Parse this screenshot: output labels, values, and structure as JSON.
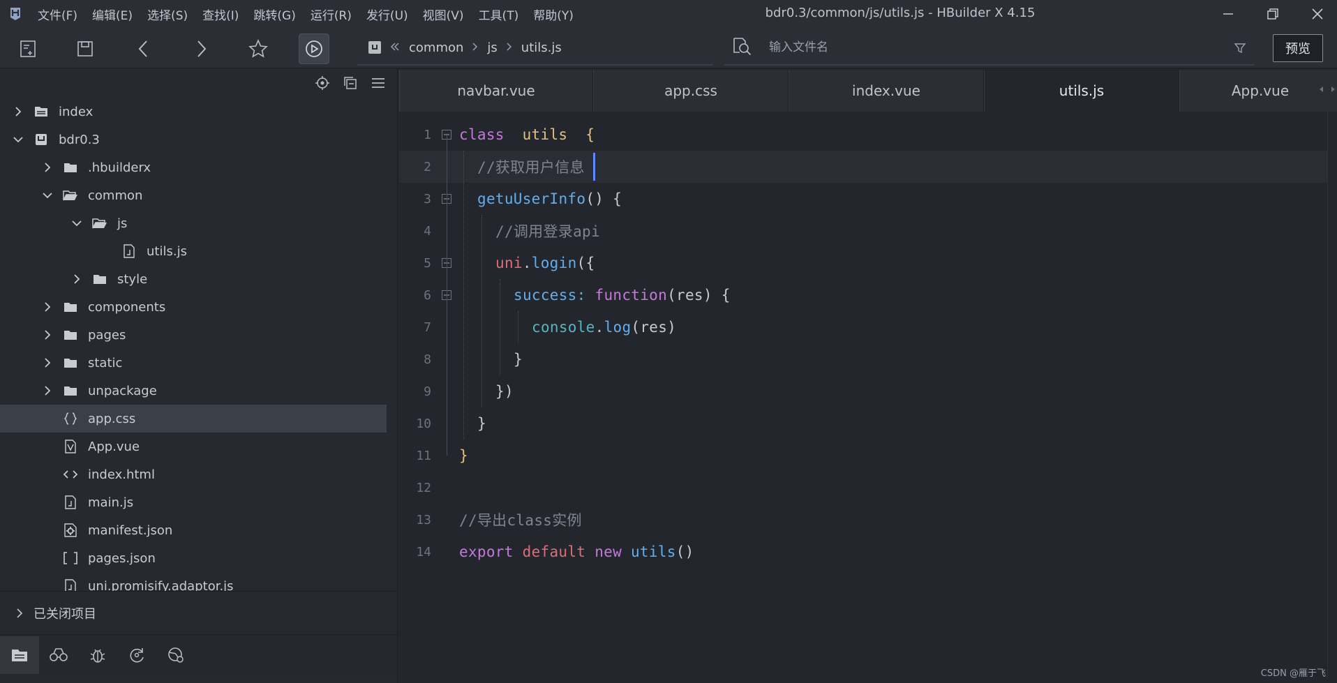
{
  "window": {
    "title": "bdr0.3/common/js/utils.js - HBuilder X 4.15"
  },
  "menu": [
    "文件(F)",
    "编辑(E)",
    "选择(S)",
    "查找(I)",
    "跳转(G)",
    "运行(R)",
    "发行(U)",
    "视图(V)",
    "工具(T)",
    "帮助(Y)"
  ],
  "toolbar": {
    "breadcrumb": [
      "common",
      "js",
      "utils.js"
    ],
    "search_placeholder": "输入文件名",
    "preview_label": "预览"
  },
  "sidebar": {
    "tree": [
      {
        "label": "index",
        "depth": 0,
        "chevron": "right",
        "icon": "project-icon"
      },
      {
        "label": "bdr0.3",
        "depth": 0,
        "chevron": "down",
        "icon": "uniapp-project-icon"
      },
      {
        "label": ".hbuilderx",
        "depth": 1,
        "chevron": "right",
        "icon": "folder-icon"
      },
      {
        "label": "common",
        "depth": 1,
        "chevron": "down",
        "icon": "folder-open-icon"
      },
      {
        "label": "js",
        "depth": 2,
        "chevron": "down",
        "icon": "folder-open-icon"
      },
      {
        "label": "utils.js",
        "depth": 3,
        "chevron": "none",
        "icon": "js-file-icon"
      },
      {
        "label": "style",
        "depth": 2,
        "chevron": "right",
        "icon": "folder-icon"
      },
      {
        "label": "components",
        "depth": 1,
        "chevron": "right",
        "icon": "folder-icon"
      },
      {
        "label": "pages",
        "depth": 1,
        "chevron": "right",
        "icon": "folder-icon"
      },
      {
        "label": "static",
        "depth": 1,
        "chevron": "right",
        "icon": "folder-icon"
      },
      {
        "label": "unpackage",
        "depth": 1,
        "chevron": "right",
        "icon": "folder-icon"
      },
      {
        "label": "app.css",
        "depth": 1,
        "chevron": "none",
        "icon": "css-file-icon",
        "selected": true
      },
      {
        "label": "App.vue",
        "depth": 1,
        "chevron": "none",
        "icon": "vue-file-icon"
      },
      {
        "label": "index.html",
        "depth": 1,
        "chevron": "none",
        "icon": "html-file-icon"
      },
      {
        "label": "main.js",
        "depth": 1,
        "chevron": "none",
        "icon": "js-file-icon"
      },
      {
        "label": "manifest.json",
        "depth": 1,
        "chevron": "none",
        "icon": "manifest-file-icon"
      },
      {
        "label": "pages.json",
        "depth": 1,
        "chevron": "none",
        "icon": "json-file-icon"
      },
      {
        "label": "uni.promisify.adaptor.js",
        "depth": 1,
        "chevron": "none",
        "icon": "js-file-icon"
      }
    ],
    "closed_projects_label": "已关闭项目"
  },
  "tabs": [
    {
      "label": "navbar.vue",
      "active": false
    },
    {
      "label": "app.css",
      "active": false
    },
    {
      "label": "index.vue",
      "active": false
    },
    {
      "label": "utils.js",
      "active": true
    },
    {
      "label": "App.vue",
      "active": false
    }
  ],
  "editor": {
    "current_line": 2,
    "lines": [
      {
        "num": "1",
        "fold": true,
        "indent": 0,
        "tokens": [
          [
            "kw-purple",
            "class"
          ],
          [
            "",
            "  "
          ],
          [
            "cls-yellow",
            "utils"
          ],
          [
            "",
            "  "
          ],
          [
            "cls-yellow",
            "{"
          ]
        ]
      },
      {
        "num": "2",
        "fold": false,
        "indent": 1,
        "tokens": [
          [
            "cmt",
            "//获取用户信息"
          ]
        ]
      },
      {
        "num": "3",
        "fold": true,
        "indent": 1,
        "tokens": [
          [
            "fn-blue",
            "getuUserInfo"
          ],
          [
            "",
            "() {"
          ]
        ]
      },
      {
        "num": "4",
        "fold": false,
        "indent": 2,
        "tokens": [
          [
            "cmt",
            "//调用登录api"
          ]
        ]
      },
      {
        "num": "5",
        "fold": true,
        "indent": 2,
        "tokens": [
          [
            "kw-red",
            "uni"
          ],
          [
            "",
            "."
          ],
          [
            "fn-blue",
            "login"
          ],
          [
            "",
            "({"
          ]
        ]
      },
      {
        "num": "6",
        "fold": true,
        "indent": 3,
        "tokens": [
          [
            "fn-blue",
            "success"
          ],
          [
            "prop-cyan",
            ":"
          ],
          [
            "",
            " "
          ],
          [
            "kw-purple",
            "function"
          ],
          [
            "",
            "(res) {"
          ]
        ]
      },
      {
        "num": "7",
        "fold": false,
        "indent": 4,
        "tokens": [
          [
            "prop-cyan",
            "console"
          ],
          [
            "",
            "."
          ],
          [
            "fn-blue",
            "log"
          ],
          [
            "",
            "(res)"
          ]
        ]
      },
      {
        "num": "8",
        "fold": false,
        "indent": 3,
        "tokens": [
          [
            "",
            "}"
          ]
        ]
      },
      {
        "num": "9",
        "fold": false,
        "indent": 2,
        "tokens": [
          [
            "",
            "})"
          ]
        ]
      },
      {
        "num": "10",
        "fold": false,
        "indent": 1,
        "tokens": [
          [
            "",
            "}"
          ]
        ]
      },
      {
        "num": "11",
        "fold": false,
        "indent": 0,
        "tokens": [
          [
            "cls-yellow",
            "}"
          ]
        ]
      },
      {
        "num": "12",
        "fold": false,
        "indent": 0,
        "tokens": []
      },
      {
        "num": "13",
        "fold": false,
        "indent": 0,
        "tokens": [
          [
            "cmt",
            "//导出class实例"
          ]
        ]
      },
      {
        "num": "14",
        "fold": false,
        "indent": 0,
        "tokens": [
          [
            "kw-purple",
            "export"
          ],
          [
            "",
            " "
          ],
          [
            "kw-red",
            "default"
          ],
          [
            "",
            " "
          ],
          [
            "kw-purple",
            "new"
          ],
          [
            "",
            " "
          ],
          [
            "fn-blue",
            "utils"
          ],
          [
            "",
            "()"
          ]
        ]
      }
    ]
  },
  "watermark": "CSDN @雁于飞"
}
